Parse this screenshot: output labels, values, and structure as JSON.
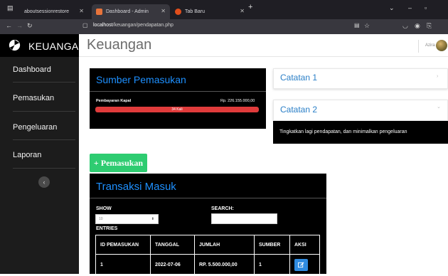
{
  "browser": {
    "tabs": [
      {
        "label": "aboutsessionrestore",
        "active": false
      },
      {
        "label": "Dashboard - Admin",
        "active": true
      },
      {
        "label": "Tab Baru",
        "active": false
      }
    ],
    "new_tab": "+",
    "url_host": "localhost",
    "url_path": "/keuangan/pendapatan.php"
  },
  "brand": {
    "name": "KEUANGAN"
  },
  "sidebar": {
    "items": [
      {
        "label": "Dashboard"
      },
      {
        "label": "Pemasukan"
      },
      {
        "label": "Pengeluaran"
      },
      {
        "label": "Laporan"
      }
    ]
  },
  "header": {
    "title": "Keuangan",
    "user_name": "Azira"
  },
  "income_sources": {
    "title": "Sumber Pemasukan",
    "items": [
      {
        "label": "Pembayaran Kapal",
        "amount": "Rp. 226.155.000,00",
        "count_text": "34 Kali",
        "progress_fraction": 1.0
      }
    ]
  },
  "notes": {
    "items": [
      {
        "title": "Catatan 1",
        "expanded": false
      },
      {
        "title": "Catatan 2",
        "expanded": true,
        "body": "Tingkatkan lagi pendapatan, dan minimalkan pengeluaran"
      }
    ]
  },
  "add_button": {
    "label": "+ Pemasukan"
  },
  "transactions": {
    "title": "Transaksi Masuk",
    "show_label": "SHOW",
    "entries_value": "10",
    "entries_label": "ENTRIES",
    "search_label": "SEARCH:",
    "columns": [
      "ID PEMASUKAN",
      "TANGGAL",
      "JUMLAH",
      "SUMBER",
      "AKSI"
    ],
    "rows": [
      {
        "id": "1",
        "date": "2022-07-06",
        "amount": "RP. 5.500.000,00",
        "source": "1"
      }
    ]
  },
  "colors": {
    "accent": "#1e90ff",
    "success": "#2ecc71",
    "danger": "#e03b3b",
    "sidebar": "#1c1c1c"
  }
}
